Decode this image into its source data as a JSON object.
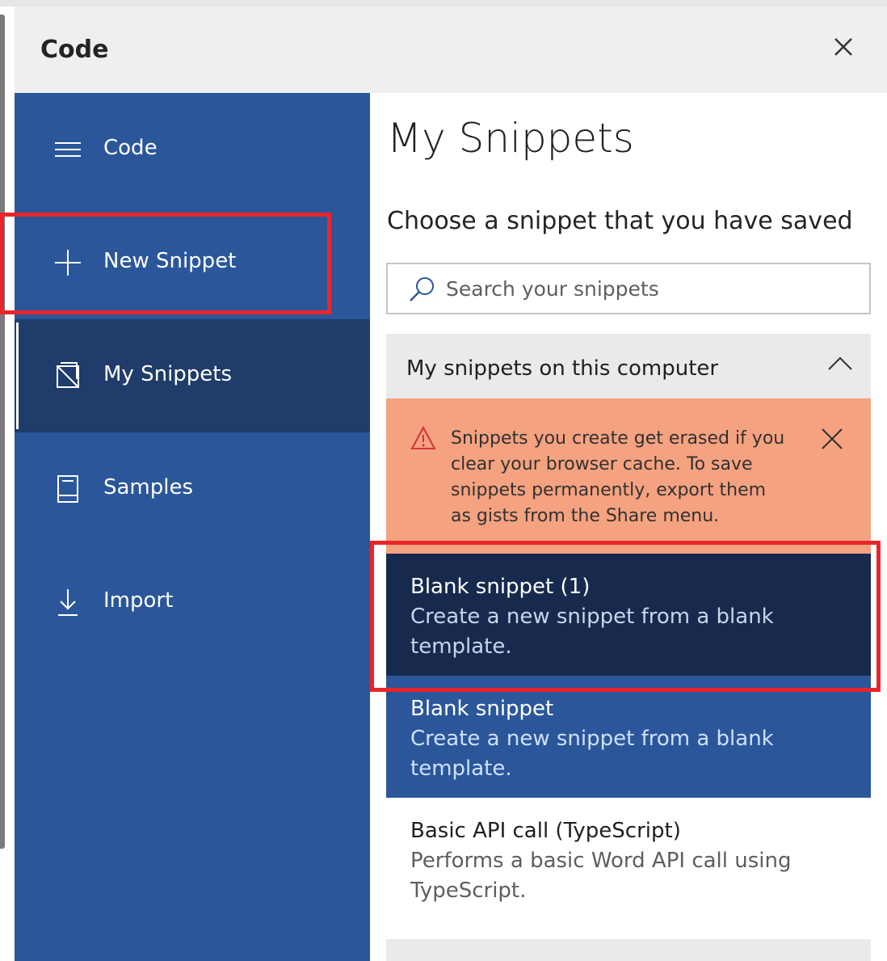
{
  "header": {
    "title": "Code",
    "close_icon": "close-icon"
  },
  "nav": {
    "items": [
      {
        "label": "Code",
        "icon": "hamburger-icon"
      },
      {
        "label": "New Snippet",
        "icon": "plus-icon"
      },
      {
        "label": "My Snippets",
        "icon": "snippets-icon",
        "selected": true
      },
      {
        "label": "Samples",
        "icon": "book-icon"
      },
      {
        "label": "Import",
        "icon": "download-icon"
      }
    ]
  },
  "main": {
    "title": "My Snippets",
    "subtitle": "Choose a snippet that you have saved",
    "search": {
      "placeholder": "Search your snippets",
      "value": ""
    },
    "group": {
      "label": "My snippets on this computer",
      "expanded": true
    },
    "warning": {
      "text": "Snippets you create get erased if you clear your browser cache. To save snippets permanently, export them as gists from the Share menu."
    },
    "snippets": [
      {
        "title": "Blank snippet (1)",
        "description": "Create a new snippet from a blank template."
      },
      {
        "title": "Blank snippet",
        "description": "Create a new snippet from a blank template."
      },
      {
        "title": "Basic API call (TypeScript)",
        "description": "Performs a basic Word API call using TypeScript."
      }
    ]
  },
  "colors": {
    "nav_bg": "#2b579a",
    "nav_selected_bg": "#1f3c6a",
    "warning_bg": "#f4a280",
    "snippet_active_bg": "#172a4e",
    "highlight_border": "#e8252a"
  }
}
